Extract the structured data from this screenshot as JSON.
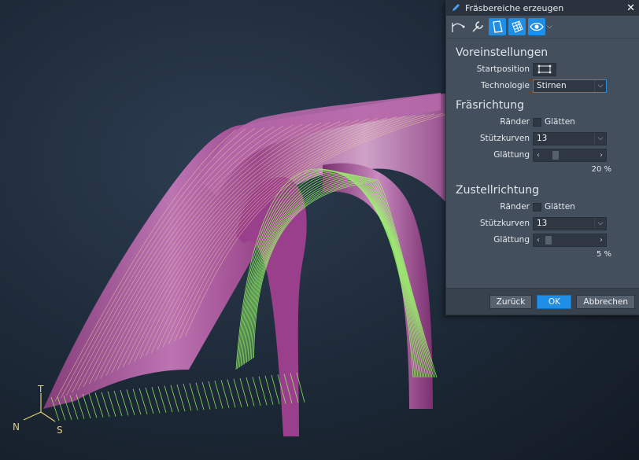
{
  "dialog": {
    "title": "Fräsbereiche erzeugen",
    "close_label": "✕",
    "toolbar": [
      {
        "name": "path-icon",
        "active": false
      },
      {
        "name": "wrench-icon",
        "active": false
      },
      {
        "name": "surface-icon",
        "active": true
      },
      {
        "name": "grid-surface-icon",
        "active": true
      },
      {
        "name": "eye-icon",
        "active": true
      }
    ],
    "preset": {
      "title": "Voreinstellungen",
      "start_label": "Startposition",
      "tech_label": "Technologie",
      "tech_value": "Stirnen"
    },
    "mill_dir": {
      "title": "Fräsrichtung",
      "edges_label": "Ränder",
      "smooth_check_label": "Glätten",
      "support_label": "Stützkurven",
      "support_value": "13",
      "smooth_label": "Glättung",
      "smooth_pct_text": "20 %",
      "smooth_pct": 20
    },
    "feed_dir": {
      "title": "Zustellrichtung",
      "edges_label": "Ränder",
      "smooth_check_label": "Glätten",
      "support_label": "Stützkurven",
      "support_value": "13",
      "smooth_label": "Glättung",
      "smooth_pct_text": "5 %",
      "smooth_pct": 5
    },
    "buttons": {
      "back": "Zurück",
      "ok": "OK",
      "cancel": "Abbrechen"
    }
  },
  "viewport": {
    "surface_color": "#a0488f",
    "toolpath_color": "#9bff6a",
    "axes": {
      "n": "N",
      "s": "S",
      "t": "T"
    }
  }
}
